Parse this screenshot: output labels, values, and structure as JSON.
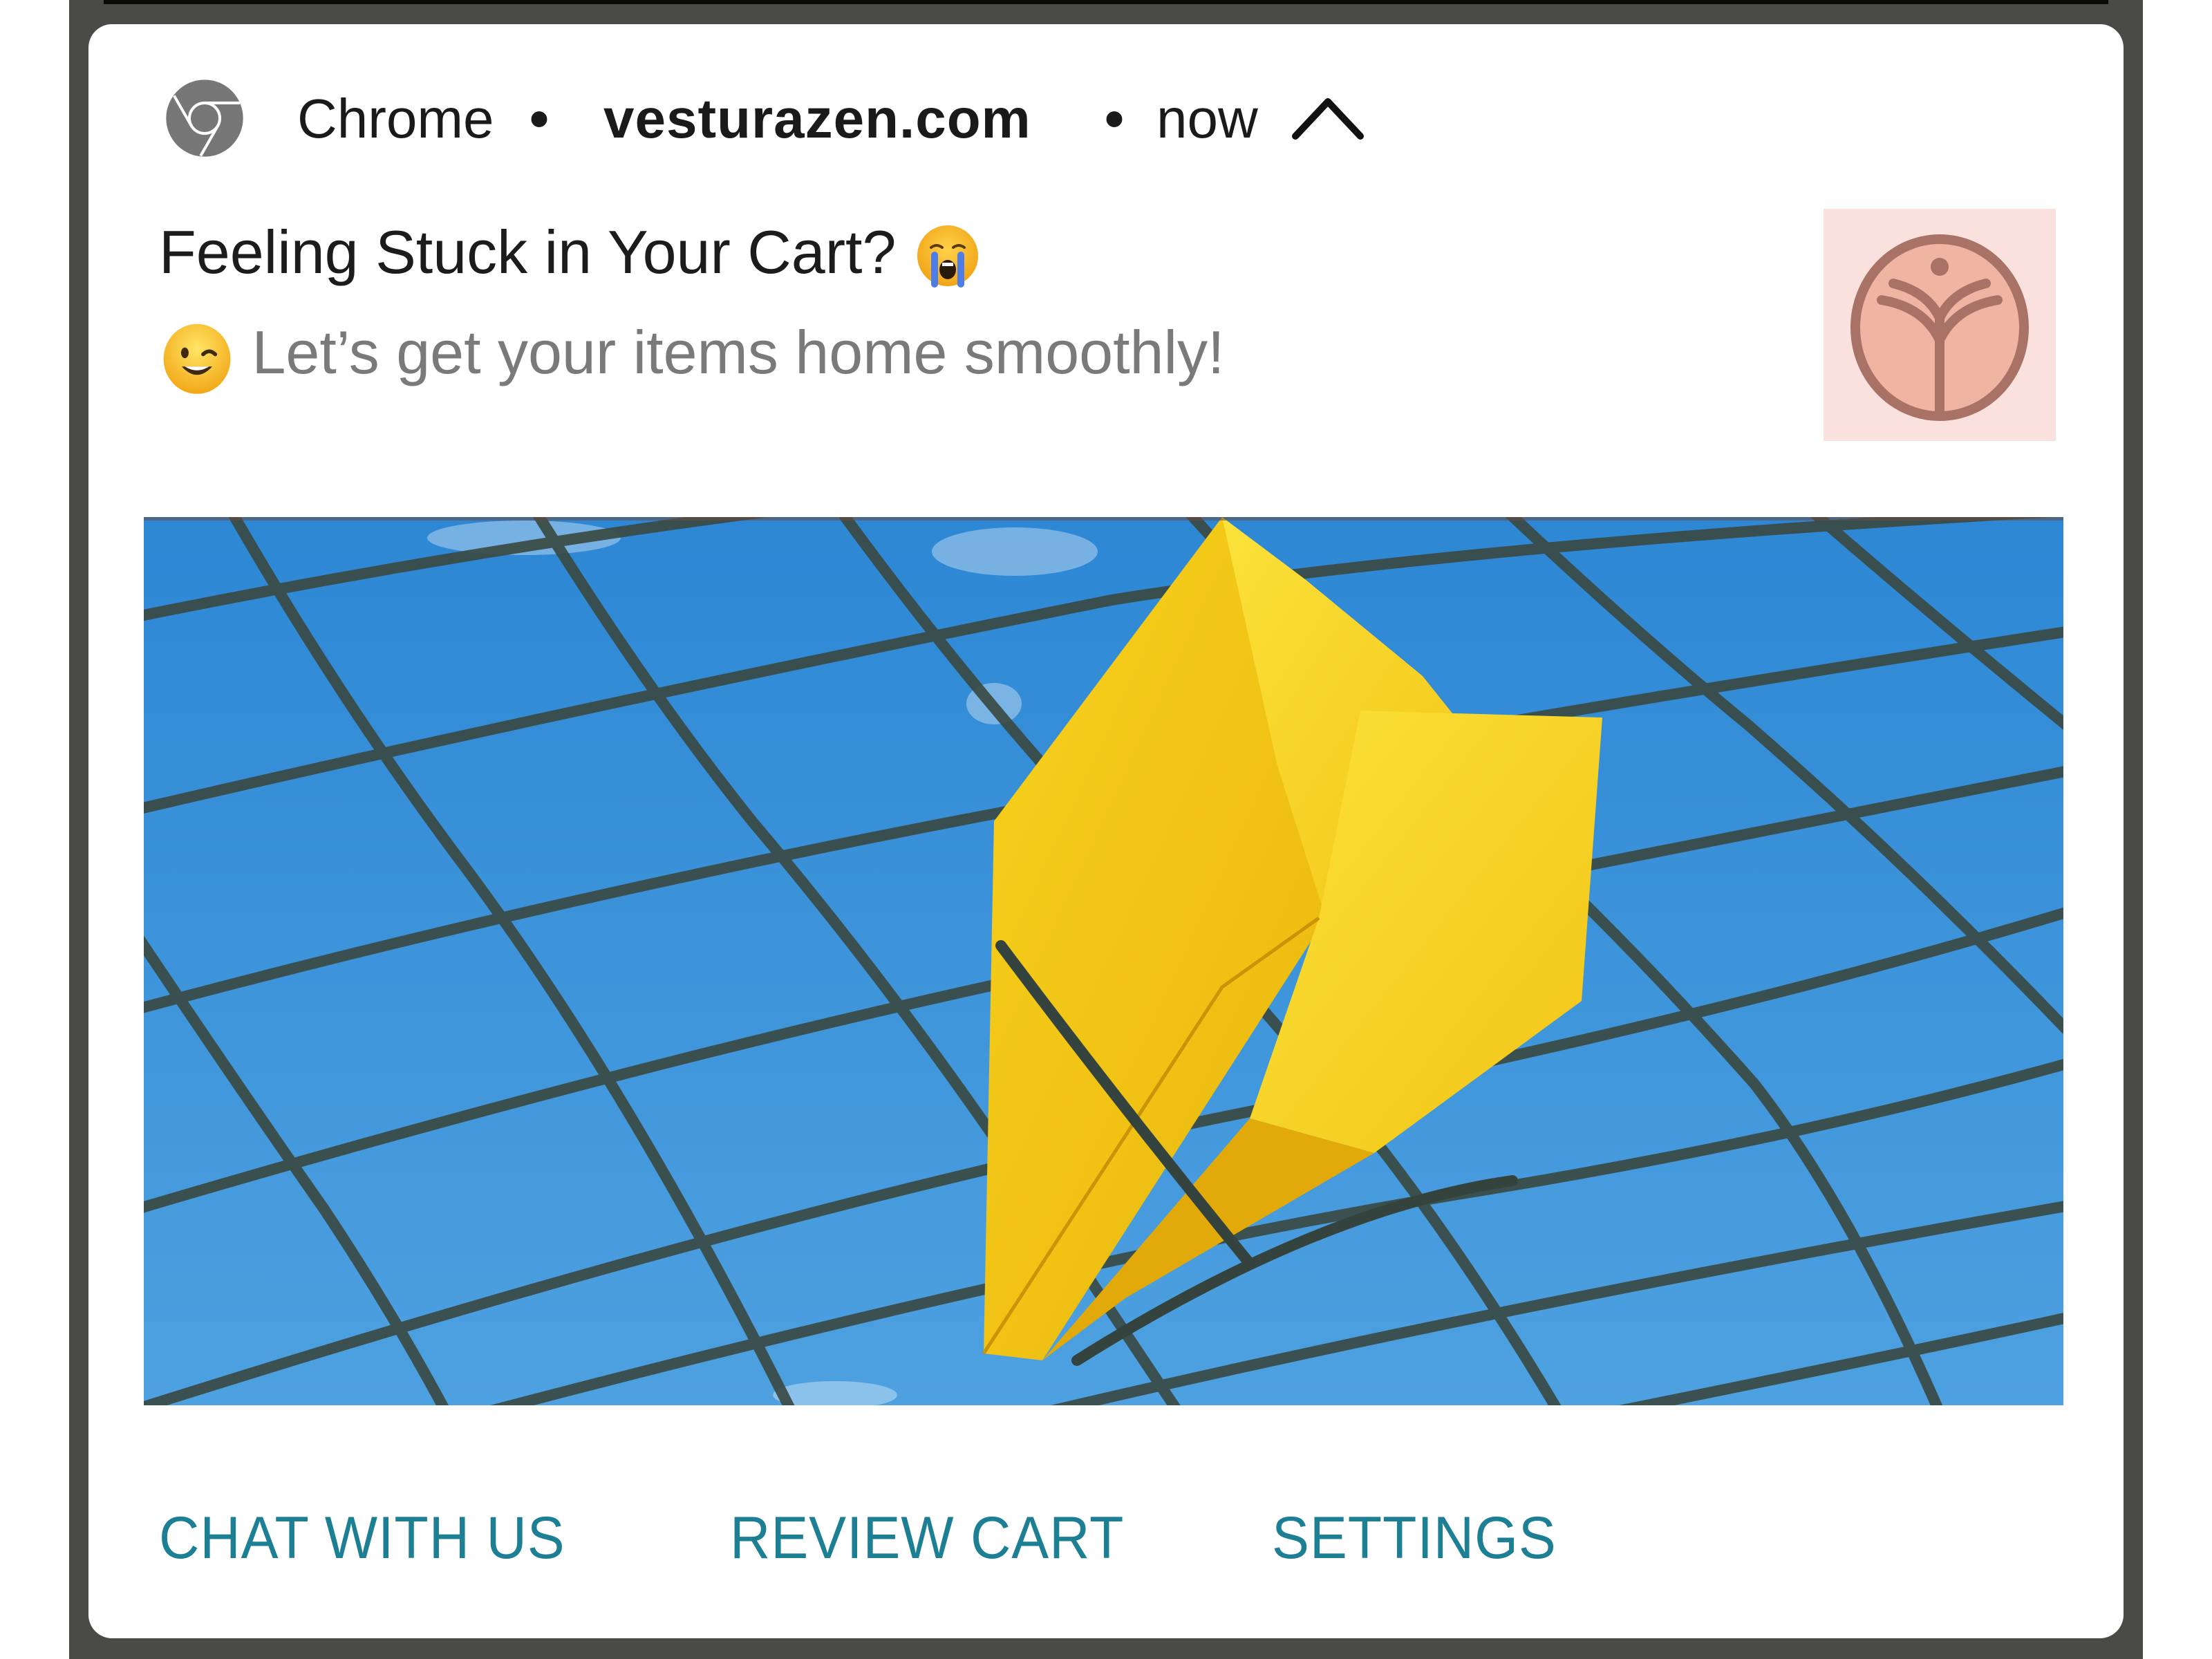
{
  "notification": {
    "header": {
      "app_icon": "chrome-icon",
      "app_name": "Chrome",
      "separator": "•",
      "site": "vesturazen.com",
      "time": "now",
      "expand_icon": "chevron-up-icon"
    },
    "title": "Feeling Stuck in Your Cart?",
    "title_emoji": "loudly-crying-face",
    "subtitle": "Let’s get your items home smoothly!",
    "subtitle_emoji": "winking-face",
    "large_icon": "brand-logo-tree-icon",
    "hero_image": "yellow-paper-plane-stuck-in-chain-link-fence",
    "actions": [
      {
        "label": "CHAT WITH US"
      },
      {
        "label": "REVIEW CART"
      },
      {
        "label": "SETTINGS"
      }
    ]
  },
  "colors": {
    "action_text": "#1d7f93",
    "frame": "#4a4b49",
    "logo_bg": "#fbe1dd",
    "logo_fill": "#f0b7a8",
    "logo_stroke": "#a57164",
    "sky": "#3690d9",
    "plane": "#f5c518"
  }
}
